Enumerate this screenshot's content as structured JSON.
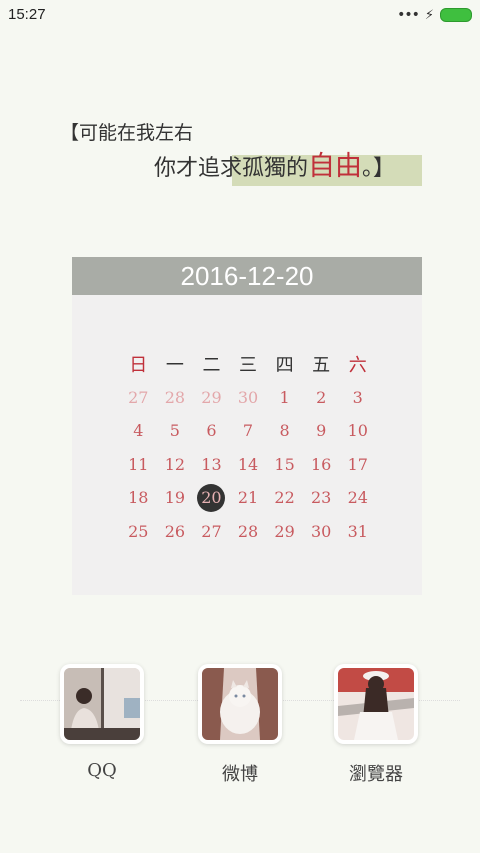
{
  "status_bar": {
    "time": "15:27",
    "signal_dots": "•••",
    "charging_symbol": "⚡"
  },
  "quote": {
    "line1": "【可能在我左右",
    "line2_prefix": "你才追求孤獨的",
    "line2_accent": "自由",
    "line2_suffix": "。】"
  },
  "calendar": {
    "date": "2016-12-20",
    "weekdays": [
      "日",
      "一",
      "二",
      "三",
      "四",
      "五",
      "六"
    ],
    "weeks": [
      [
        "27",
        "28",
        "29",
        "30",
        "1",
        "2",
        "3"
      ],
      [
        "4",
        "5",
        "6",
        "7",
        "8",
        "9",
        "10"
      ],
      [
        "11",
        "12",
        "13",
        "14",
        "15",
        "16",
        "17"
      ],
      [
        "18",
        "19",
        "20",
        "21",
        "22",
        "23",
        "24"
      ],
      [
        "25",
        "26",
        "27",
        "28",
        "29",
        "30",
        "31"
      ]
    ],
    "today": "20"
  },
  "dock": [
    {
      "label": "QQ",
      "icon": "photo-girl-window-icon"
    },
    {
      "label": "微博",
      "icon": "photo-girl-cat-icon"
    },
    {
      "label": "瀏覽器",
      "icon": "photo-girl-hat-icon"
    }
  ],
  "colors": {
    "accent": "#c0303a",
    "highlight": "#d4dcb8",
    "header": "#a9aca6"
  }
}
